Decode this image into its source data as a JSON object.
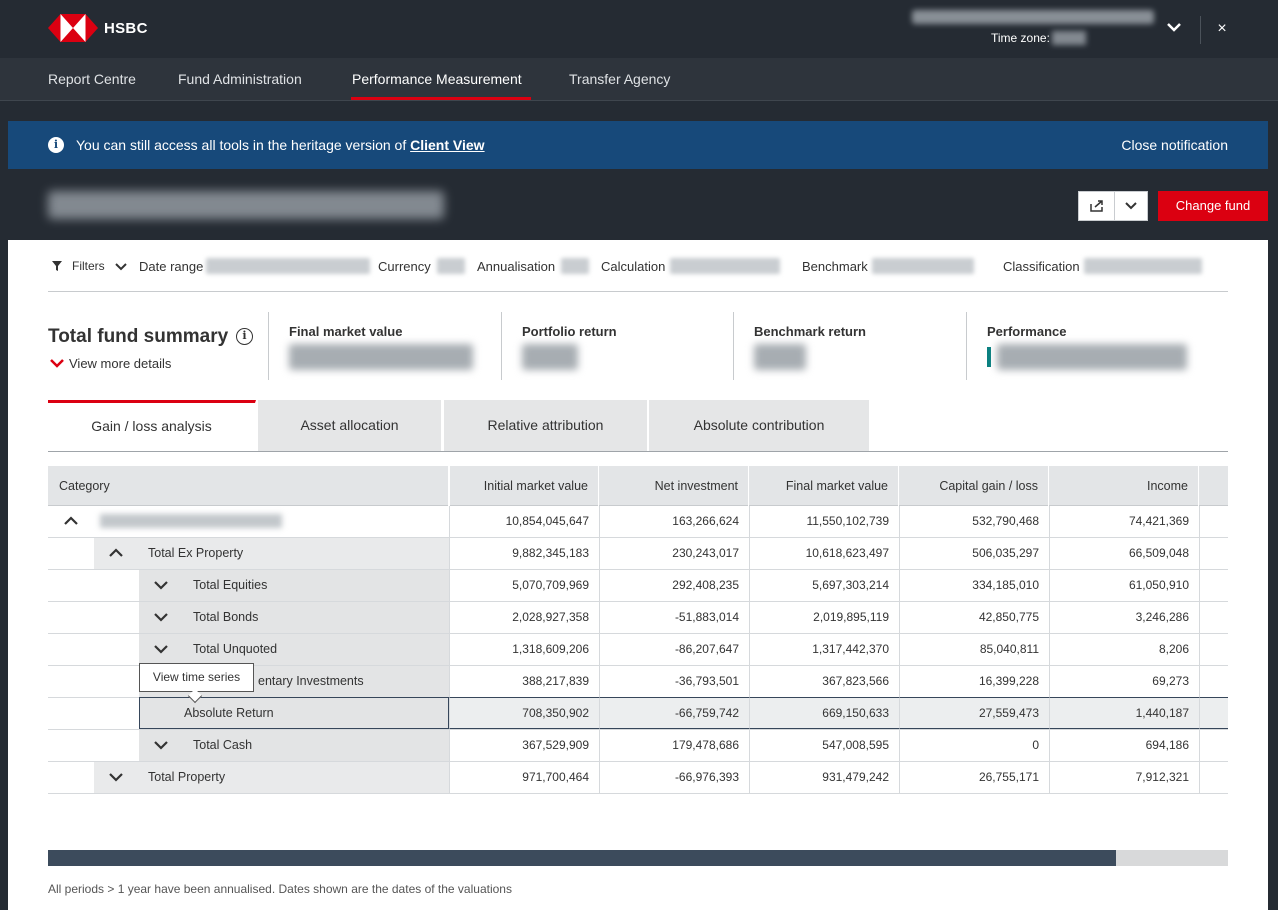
{
  "brand": {
    "name": "HSBC",
    "accent": "#db0011"
  },
  "header": {
    "timezone_label": "Time zone:",
    "close_icon": "×"
  },
  "nav": {
    "items": [
      {
        "label": "Report Centre"
      },
      {
        "label": "Fund Administration"
      },
      {
        "label": "Performance Measurement",
        "active": true
      },
      {
        "label": "Transfer Agency"
      }
    ]
  },
  "notification": {
    "text": "You can still access all tools in the heritage version of",
    "link": "Client View",
    "close": "Close notification",
    "color": "#17497a"
  },
  "fund": {
    "change_label": "Change fund"
  },
  "filters": {
    "toggle": "Filters",
    "date_range": "Date range",
    "currency": "Currency",
    "annualisation": "Annualisation",
    "calculation": "Calculation",
    "benchmark": "Benchmark",
    "classification": "Classification"
  },
  "summary": {
    "title": "Total fund summary",
    "more": "View more details",
    "kpis": [
      {
        "label": "Final market value"
      },
      {
        "label": "Portfolio return"
      },
      {
        "label": "Benchmark return"
      },
      {
        "label": "Performance"
      }
    ]
  },
  "tabs": [
    {
      "label": "Gain / loss analysis",
      "active": true
    },
    {
      "label": "Asset allocation"
    },
    {
      "label": "Relative attribution"
    },
    {
      "label": "Absolute contribution"
    }
  ],
  "table": {
    "columns": [
      "Category",
      "Initial market value",
      "Net investment",
      "Final market value",
      "Capital gain / loss",
      "Income"
    ],
    "rows": [
      {
        "label": "",
        "values": [
          "10,854,045,647",
          "163,266,624",
          "11,550,102,739",
          "532,790,468",
          "74,421,369"
        ]
      },
      {
        "label": "Total Ex Property",
        "values": [
          "9,882,345,183",
          "230,243,017",
          "10,618,623,497",
          "506,035,297",
          "66,509,048"
        ]
      },
      {
        "label": "Total Equities",
        "values": [
          "5,070,709,969",
          "292,408,235",
          "5,697,303,214",
          "334,185,010",
          "61,050,910"
        ]
      },
      {
        "label": "Total Bonds",
        "values": [
          "2,028,927,358",
          "-51,883,014",
          "2,019,895,119",
          "42,850,775",
          "3,246,286"
        ]
      },
      {
        "label": "Total Unquoted",
        "values": [
          "1,318,609,206",
          "-86,207,647",
          "1,317,442,370",
          "85,040,811",
          "8,206"
        ]
      },
      {
        "label": "entary Investments",
        "values": [
          "388,217,839",
          "-36,793,501",
          "367,823,566",
          "16,399,228",
          "69,273"
        ]
      },
      {
        "label": "Absolute Return",
        "values": [
          "708,350,902",
          "-66,759,742",
          "669,150,633",
          "27,559,473",
          "1,440,187"
        ]
      },
      {
        "label": "Total Cash",
        "values": [
          "367,529,909",
          "179,478,686",
          "547,008,595",
          "0",
          "694,186"
        ]
      },
      {
        "label": "Total Property",
        "values": [
          "971,700,464",
          "-66,976,393",
          "931,479,242",
          "26,755,171",
          "7,912,321"
        ]
      }
    ]
  },
  "tooltip": "View time series",
  "footnote": "All periods > 1 year have been annualised. Dates shown are the dates of the valuations"
}
